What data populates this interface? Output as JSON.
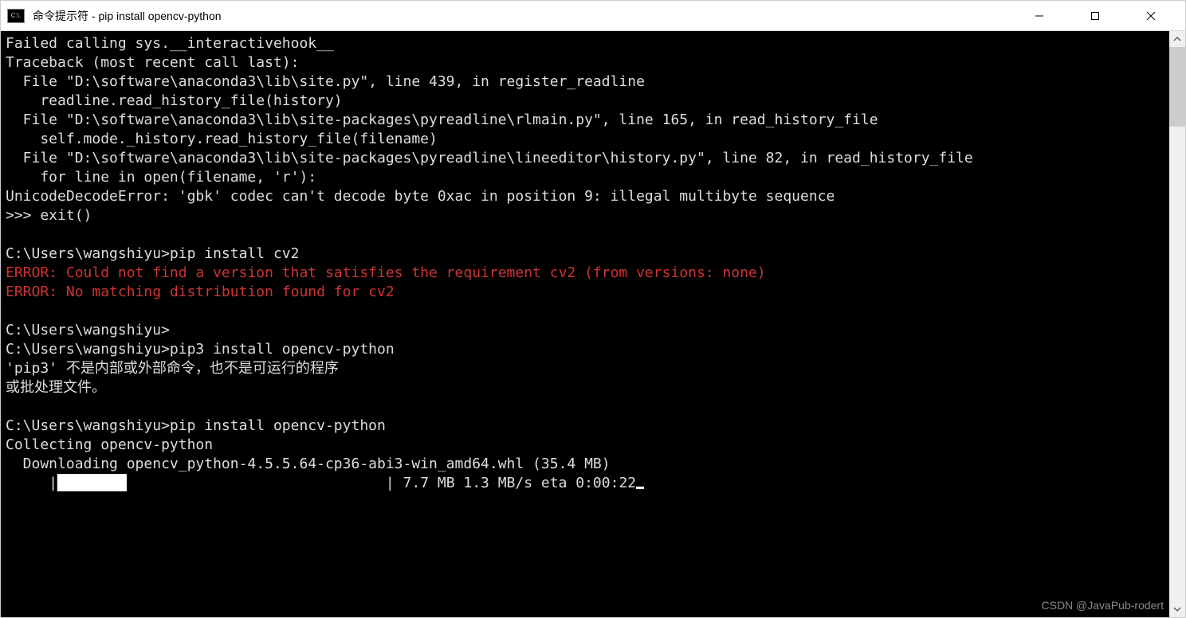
{
  "window": {
    "title": "命令提示符 - pip  install opencv-python",
    "icon_text": "C:\\."
  },
  "terminal": {
    "line1": "Failed calling sys.__interactivehook__",
    "line2": "Traceback (most recent call last):",
    "line3": "  File \"D:\\software\\anaconda3\\lib\\site.py\", line 439, in register_readline",
    "line4": "    readline.read_history_file(history)",
    "line5": "  File \"D:\\software\\anaconda3\\lib\\site-packages\\pyreadline\\rlmain.py\", line 165, in read_history_file",
    "line6": "    self.mode._history.read_history_file(filename)",
    "line7": "  File \"D:\\software\\anaconda3\\lib\\site-packages\\pyreadline\\lineeditor\\history.py\", line 82, in read_history_file",
    "line8": "    for line in open(filename, 'r'):",
    "line9": "UnicodeDecodeError: 'gbk' codec can't decode byte 0xac in position 9: illegal multibyte sequence",
    "line10": ">>> exit()",
    "line11": "",
    "line12": "C:\\Users\\wangshiyu>pip install cv2",
    "line13_error": "ERROR: Could not find a version that satisfies the requirement cv2 (from versions: none)",
    "line14_error": "ERROR: No matching distribution found for cv2",
    "line15": "",
    "line16": "C:\\Users\\wangshiyu>",
    "line17": "C:\\Users\\wangshiyu>pip3 install opencv-python",
    "line18": "'pip3' 不是内部或外部命令，也不是可运行的程序",
    "line19": "或批处理文件。",
    "line20": "",
    "line21": "C:\\Users\\wangshiyu>pip install opencv-python",
    "line22": "Collecting opencv-python",
    "line23": "  Downloading opencv_python-4.5.5.64-cp36-abi3-win_amd64.whl (35.4 MB)",
    "progress_prefix": "     |",
    "progress_fill": "████████",
    "progress_empty": "                              ",
    "progress_suffix": "| 7.7 MB 1.3 MB/s eta 0:00:22"
  },
  "watermark": "CSDN @JavaPub-rodert"
}
